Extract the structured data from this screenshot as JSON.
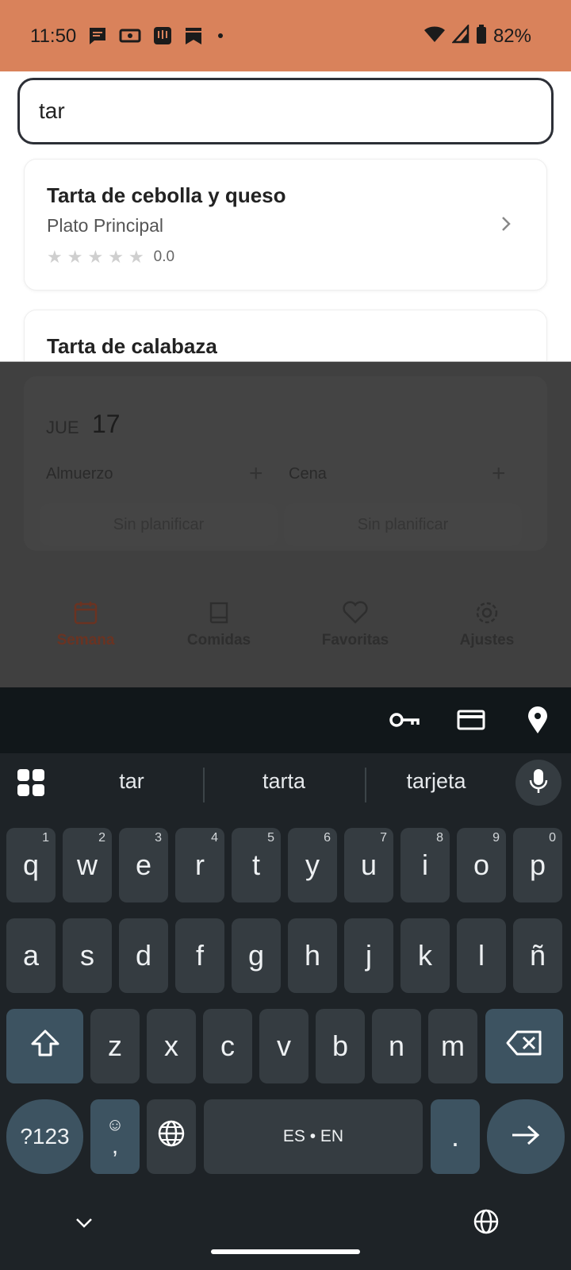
{
  "status_bar": {
    "time": "11:50",
    "battery": "82%",
    "notification_icons": [
      "message-icon",
      "ticket-icon",
      "intercom-icon",
      "bookmark-icon",
      "dot-icon"
    ],
    "system_icons": [
      "wifi-icon",
      "signal-icon",
      "battery-icon"
    ],
    "color": "#D9825B"
  },
  "search": {
    "value": "tar"
  },
  "results": [
    {
      "title": "Tarta de cebolla y queso",
      "category": "Plato Principal",
      "rating": "0.0",
      "stars": 0
    },
    {
      "title": "Tarta de calabaza"
    }
  ],
  "week_view": {
    "day_abbr": "JUE",
    "day_num": "17",
    "meals": [
      {
        "label": "Almuerzo",
        "slot": "Sin planificar"
      },
      {
        "label": "Cena",
        "slot": "Sin planificar"
      }
    ]
  },
  "bottom_nav": [
    {
      "label": "Semana",
      "icon": "calendar-icon",
      "active": true
    },
    {
      "label": "Comidas",
      "icon": "book-icon",
      "active": false
    },
    {
      "label": "Favoritas",
      "icon": "heart-icon",
      "active": false
    },
    {
      "label": "Ajustes",
      "icon": "gear-icon",
      "active": false
    }
  ],
  "keyboard": {
    "toolbar_icons": [
      "key-icon",
      "card-icon",
      "location-icon"
    ],
    "suggestions": [
      "tar",
      "tarta",
      "tarjeta"
    ],
    "row1": [
      {
        "k": "q",
        "n": "1"
      },
      {
        "k": "w",
        "n": "2"
      },
      {
        "k": "e",
        "n": "3"
      },
      {
        "k": "r",
        "n": "4"
      },
      {
        "k": "t",
        "n": "5"
      },
      {
        "k": "y",
        "n": "6"
      },
      {
        "k": "u",
        "n": "7"
      },
      {
        "k": "i",
        "n": "8"
      },
      {
        "k": "o",
        "n": "9"
      },
      {
        "k": "p",
        "n": "0"
      }
    ],
    "row2": [
      "a",
      "s",
      "d",
      "f",
      "g",
      "h",
      "j",
      "k",
      "l",
      "ñ"
    ],
    "row3": [
      "z",
      "x",
      "c",
      "v",
      "b",
      "n",
      "m"
    ],
    "symbols_label": "?123",
    "comma_label": ",",
    "space_label": "ES • EN",
    "period_label": "."
  }
}
